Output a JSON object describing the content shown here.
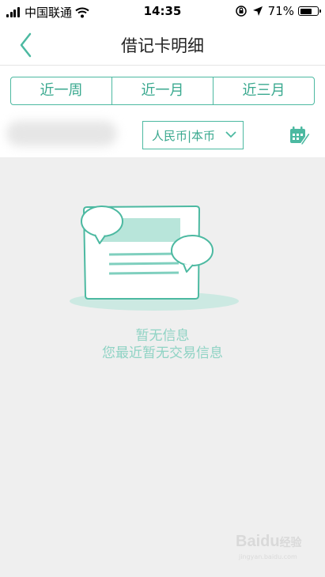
{
  "status_bar": {
    "carrier": "中国联通",
    "time": "14:35",
    "battery_percent": "71%",
    "battery_level": 0.71,
    "icons": [
      "signal-icon",
      "wifi-icon",
      "rotation-lock-icon",
      "location-icon",
      "battery-icon"
    ]
  },
  "nav": {
    "title": "借记卡明细",
    "back_icon": "chevron-left-icon"
  },
  "filters": {
    "periods": [
      "近一周",
      "近一月",
      "近三月"
    ],
    "currency": "人民币|本币",
    "calendar_icon": "calendar-edit-icon"
  },
  "empty_state": {
    "title": "暂无信息",
    "subtitle": "您最近暂无交易信息"
  },
  "watermark": {
    "brand": "Baidu",
    "brand_cn": "经验",
    "url": "jingyan.baidu.com"
  },
  "colors": {
    "accent": "#4cb9a1",
    "accent_text": "#3aa98f",
    "empty_text": "#8fd3c4",
    "background": "#efefef"
  }
}
